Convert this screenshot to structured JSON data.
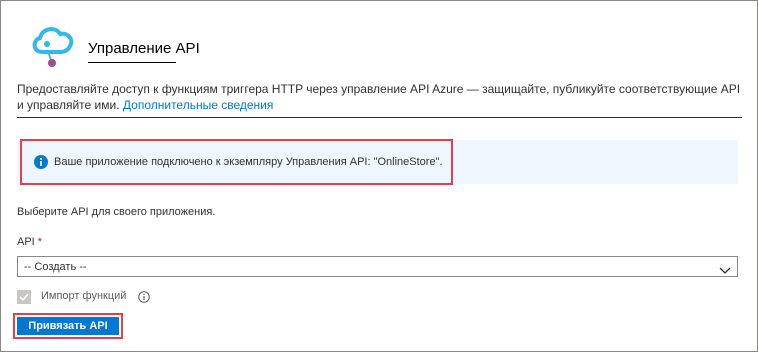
{
  "header": {
    "title": "Управление API"
  },
  "description": {
    "text": "Предоставляйте доступ к функциям триггера HTTP через управление API Azure — защищайте, публикуйте соответствующие API и управляйте ими. ",
    "link": "Дополнительные сведения"
  },
  "info": {
    "icon": "info-icon",
    "message": "Ваше приложение подключено к экземпляру Управления API: \"OnlineStore\"."
  },
  "form": {
    "choose_text": "Выберите API для своего приложения.",
    "api_label": "API",
    "required_mark": "*",
    "api_select_value": "-- Создать --",
    "import_label": "Импорт функций",
    "import_checked": true,
    "submit_label": "Привязать API"
  },
  "colors": {
    "accent": "#0078d4",
    "highlight": "#e0424c",
    "info_background": "#f0f6ff",
    "required": "#a4262c"
  }
}
